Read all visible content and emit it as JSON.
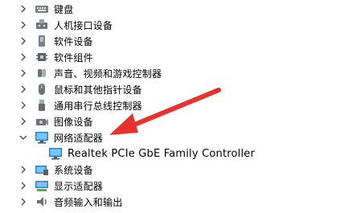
{
  "tree": {
    "items": [
      {
        "label": "键盘",
        "icon": "keyboard-icon",
        "expanded": false
      },
      {
        "label": "人机接口设备",
        "icon": "hid-icon",
        "expanded": false
      },
      {
        "label": "软件设备",
        "icon": "software-device-icon",
        "expanded": false
      },
      {
        "label": "软件组件",
        "icon": "software-component-icon",
        "expanded": false
      },
      {
        "label": "声音、视频和游戏控制器",
        "icon": "speaker-icon",
        "expanded": false
      },
      {
        "label": "鼠标和其他指针设备",
        "icon": "mouse-icon",
        "expanded": false
      },
      {
        "label": "通用串行总线控制器",
        "icon": "usb-icon",
        "expanded": false
      },
      {
        "label": "图像设备",
        "icon": "camera-icon",
        "expanded": false
      },
      {
        "label": "网络适配器",
        "icon": "network-adapter-icon",
        "expanded": true
      },
      {
        "label": "Realtek PCIe GbE Family Controller",
        "icon": "network-adapter-icon",
        "child": true
      },
      {
        "label": "系统设备",
        "icon": "system-device-icon",
        "expanded": false
      },
      {
        "label": "显示适配器",
        "icon": "display-adapter-icon",
        "expanded": false
      },
      {
        "label": "音频输入和输出",
        "icon": "audio-io-icon",
        "expanded": false
      }
    ]
  },
  "annotation": {
    "arrow_color": "#e8322d"
  }
}
